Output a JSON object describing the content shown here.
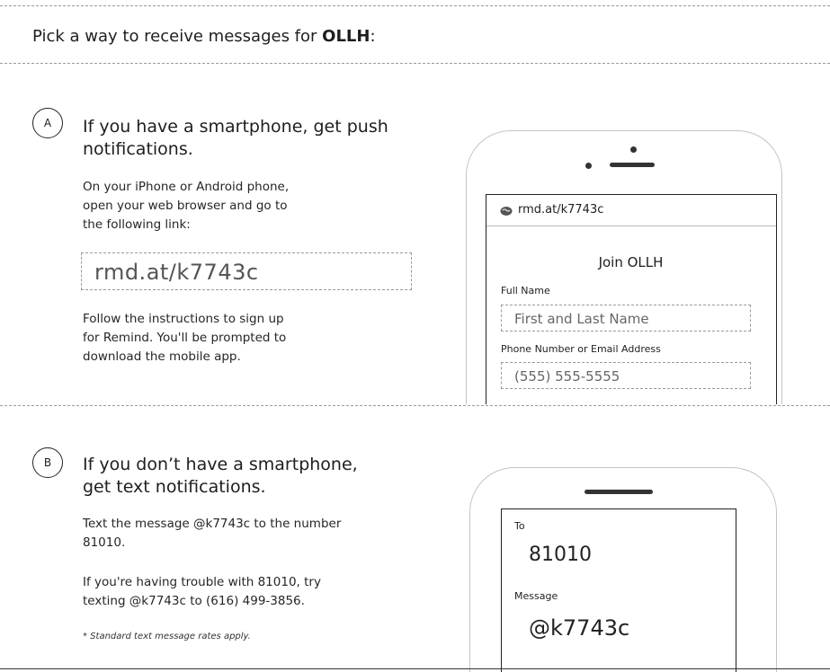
{
  "header": {
    "prefix": "Pick a way to receive messages for ",
    "group": "OLLH",
    "suffix": ":"
  },
  "section_a": {
    "badge": "A",
    "title_line1": "If you have a smartphone, get push",
    "title_line2": "notifications.",
    "instructions_lines": [
      "On your iPhone or Android phone,",
      "open your web browser and go to",
      "the following link:"
    ],
    "link": "rmd.at/k7743c",
    "follow_lines": [
      "Follow the instructions to sign up",
      "for Remind. You'll be prompted to",
      "download the mobile app."
    ]
  },
  "phone_a": {
    "url_icon": "brain-icon",
    "url": "rmd.at/k7743c",
    "join_title": "Join OLLH",
    "full_name_label": "Full Name",
    "full_name_placeholder": "First and Last Name",
    "contact_label": "Phone Number or Email Address",
    "contact_placeholder": "(555) 555-5555"
  },
  "section_b": {
    "badge": "B",
    "title_line1": "If you don’t have a smartphone,",
    "title_line2": "get text notifications.",
    "text_lines": [
      "Text the message @k7743c to the number",
      "81010."
    ],
    "trouble_lines": [
      "If you're having trouble with 81010, try",
      "texting @k7743c to (616) 499-3856."
    ],
    "footnote": "* Standard text message rates apply."
  },
  "phone_b": {
    "to_label": "To",
    "to_value": "81010",
    "message_label": "Message",
    "message_value": "@k7743c"
  }
}
